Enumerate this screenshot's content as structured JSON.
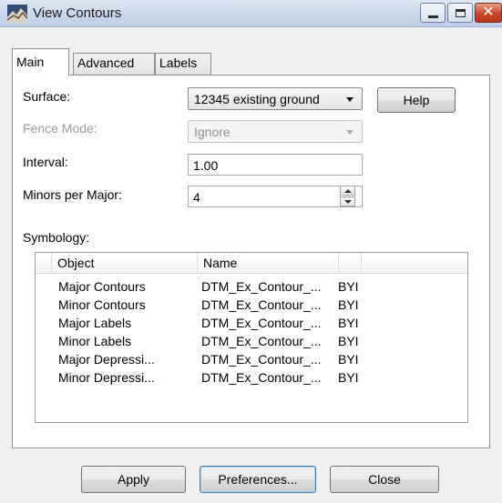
{
  "window": {
    "title": "View Contours"
  },
  "tabs": [
    {
      "label": "Main",
      "active": true
    },
    {
      "label": "Advanced",
      "active": false
    },
    {
      "label": "Labels",
      "active": false
    }
  ],
  "main": {
    "surface_label": "Surface:",
    "surface_value": "12345 existing ground",
    "help_label": "Help",
    "fence_mode_label": "Fence Mode:",
    "fence_mode_value": "Ignore",
    "interval_label": "Interval:",
    "interval_value": "1.00",
    "minors_label": "Minors per Major:",
    "minors_value": "4",
    "symbology_label": "Symbology:",
    "symbology": {
      "columns": [
        "Object",
        "Name",
        ""
      ],
      "rows": [
        [
          "Major Contours",
          "DTM_Ex_Contour_...",
          "BYI"
        ],
        [
          "Minor Contours",
          "DTM_Ex_Contour_...",
          "BYI"
        ],
        [
          "Major Labels",
          "DTM_Ex_Contour_...",
          "BYI"
        ],
        [
          "Minor Labels",
          "DTM_Ex_Contour_...",
          "BYI"
        ],
        [
          "Major Depressi...",
          "DTM_Ex_Contour_...",
          "BYI"
        ],
        [
          "Minor Depressi...",
          "DTM_Ex_Contour_...",
          "BYI"
        ]
      ]
    }
  },
  "footer": {
    "apply_label": "Apply",
    "preferences_label": "Preferences...",
    "close_label": "Close"
  },
  "icons": {
    "app": "contour-app-icon",
    "minimize": "minimize-icon",
    "maximize": "maximize-icon",
    "close": "close-icon",
    "dropdown": "chevron-down-icon",
    "spin_up": "spin-up-icon",
    "spin_down": "spin-down-icon"
  },
  "colors": {
    "close_button": "#c7462a",
    "default_button_border": "#3c7fb1",
    "disabled_text": "#9a9a9a"
  }
}
